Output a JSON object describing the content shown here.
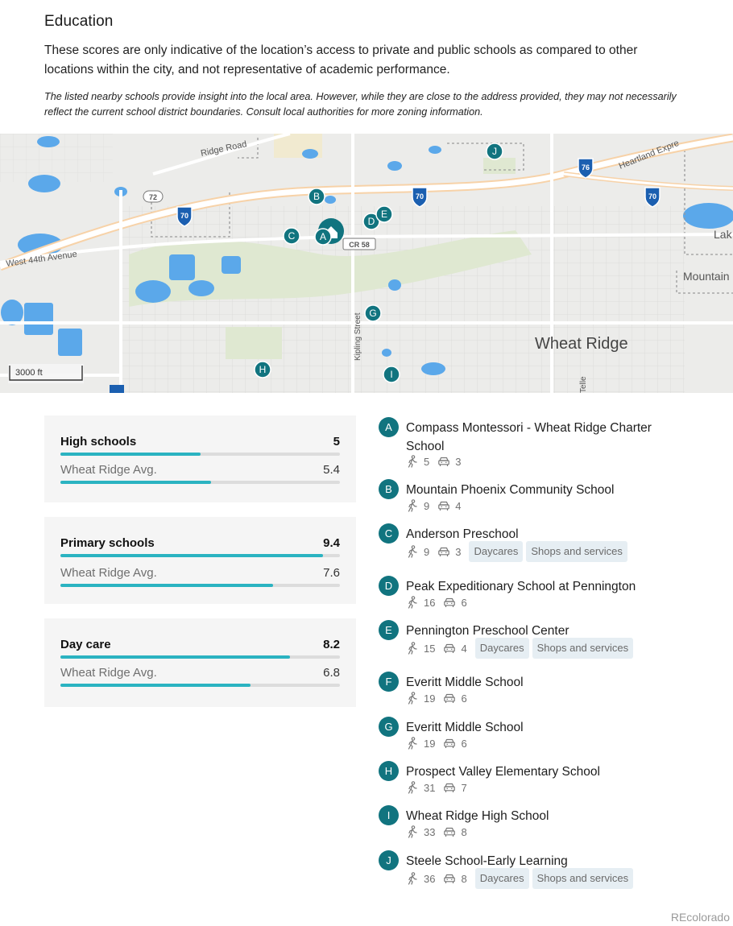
{
  "education": {
    "title": "Education",
    "intro": "These scores are only indicative of the location’s access to private and public schools as compared to other locations within the city, and not representative of academic performance.",
    "note": "The listed nearby schools provide insight into the local area. However, while they are close to the address provided, they may not necessarily reflect the current school district boundaries. Consult local authorities for more zoning information."
  },
  "map": {
    "scale": "3000 ft",
    "labels": {
      "ridge_road": "Ridge Road",
      "west_44th": "West 44th Avenue",
      "kipling": "Kipling Street",
      "heartland": "Heartland Expre",
      "wheat_ridge": "Wheat Ridge",
      "lake": "Lak",
      "mountain": "Mountain",
      "telle": "Telle"
    },
    "shields": {
      "i70": "70",
      "i76": "76",
      "co72": "72",
      "cr58": "CR 58"
    },
    "markers": [
      "A",
      "B",
      "C",
      "D",
      "E",
      "G",
      "H",
      "I",
      "J"
    ]
  },
  "scores": [
    {
      "label": "High schools",
      "value": "5",
      "fill": 0.5,
      "avg_label": "Wheat Ridge Avg.",
      "avg_value": "5.4",
      "avg_fill": 0.54
    },
    {
      "label": "Primary schools",
      "value": "9.4",
      "fill": 0.94,
      "avg_label": "Wheat Ridge Avg.",
      "avg_value": "7.6",
      "avg_fill": 0.76
    },
    {
      "label": "Day care",
      "value": "8.2",
      "fill": 0.82,
      "avg_label": "Wheat Ridge Avg.",
      "avg_value": "6.8",
      "avg_fill": 0.68
    }
  ],
  "schools": [
    {
      "letter": "A",
      "name": "Compass Montessori - Wheat Ridge Charter School",
      "walk": "5",
      "drive": "3",
      "tags": []
    },
    {
      "letter": "B",
      "name": "Mountain Phoenix Community School",
      "walk": "9",
      "drive": "4",
      "tags": []
    },
    {
      "letter": "C",
      "name": "Anderson Preschool",
      "walk": "9",
      "drive": "3",
      "tags": [
        "Daycares",
        "Shops and services"
      ]
    },
    {
      "letter": "D",
      "name": "Peak Expeditionary School at Pennington",
      "walk": "16",
      "drive": "6",
      "tags": []
    },
    {
      "letter": "E",
      "name": "Pennington Preschool Center",
      "walk": "15",
      "drive": "4",
      "tags": [
        "Daycares",
        "Shops and services"
      ]
    },
    {
      "letter": "F",
      "name": "Everitt Middle School",
      "walk": "19",
      "drive": "6",
      "tags": []
    },
    {
      "letter": "G",
      "name": "Everitt Middle School",
      "walk": "19",
      "drive": "6",
      "tags": []
    },
    {
      "letter": "H",
      "name": "Prospect Valley Elementary School",
      "walk": "31",
      "drive": "7",
      "tags": []
    },
    {
      "letter": "I",
      "name": "Wheat Ridge High School",
      "walk": "33",
      "drive": "8",
      "tags": []
    },
    {
      "letter": "J",
      "name": "Steele School-Early Learning",
      "walk": "36",
      "drive": "8",
      "tags": [
        "Daycares",
        "Shops and services"
      ]
    }
  ],
  "footer": {
    "brand": "REcolorado"
  },
  "colors": {
    "accent": "#2bb3c1",
    "marker": "#11747f",
    "tag_bg": "#e6eef3",
    "water": "#5ba8ea",
    "park": "#dfe8d1"
  },
  "icons": {
    "walk": "walk-icon",
    "drive": "car-icon"
  }
}
